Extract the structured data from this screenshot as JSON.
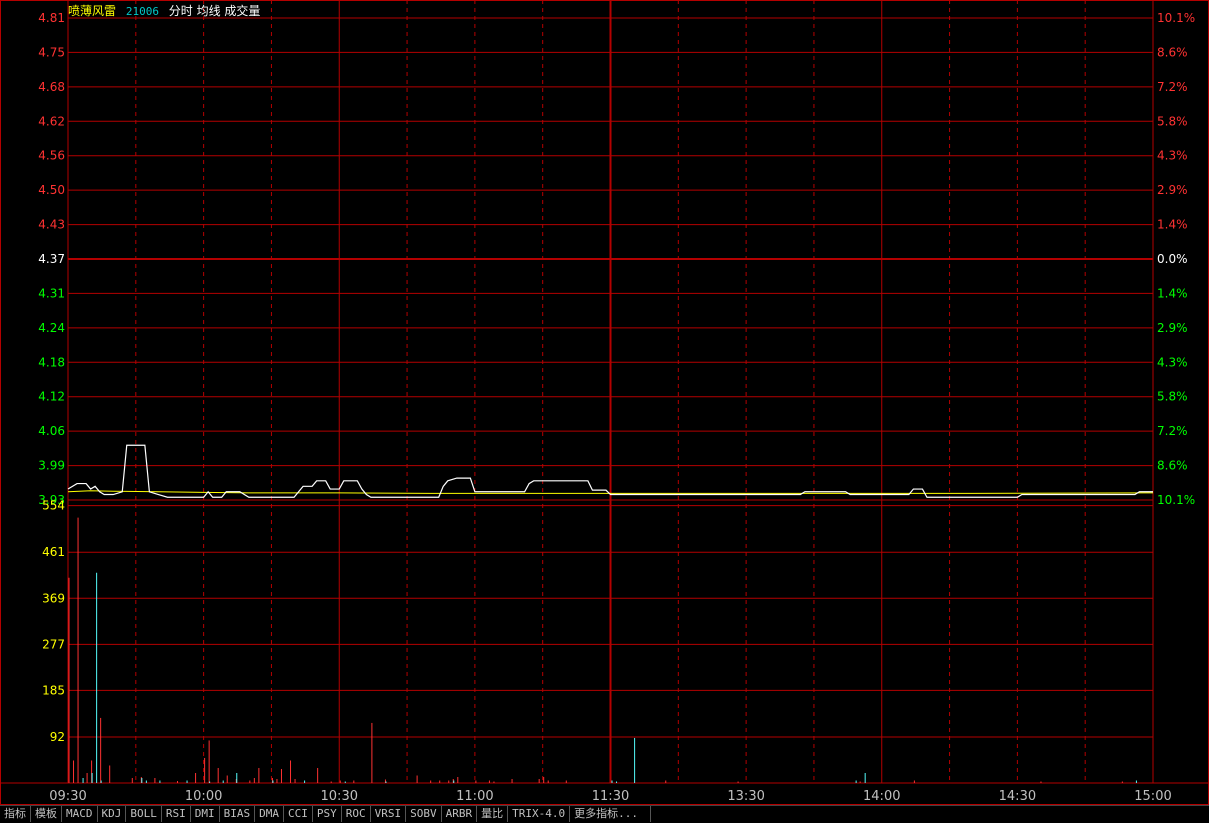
{
  "header": {
    "stock_name": "喷薄风雷",
    "stock_code": "21006",
    "chart_items": "分时 均线 成交量"
  },
  "tabs": [
    "指标",
    "模板",
    "MACD",
    "KDJ",
    "BOLL",
    "RSI",
    "DMI",
    "BIAS",
    "DMA",
    "CCI",
    "PSY",
    "ROC",
    "VRSI",
    "SOBV",
    "ARBR",
    "量比",
    "TRIX-4.0",
    "更多指标..."
  ],
  "colors": {
    "grid": "#b40000",
    "up": "#ff3232",
    "down": "#00ff00",
    "flat": "#ffffff",
    "price_line": "#ffffff",
    "avg_line": "#ffff00",
    "vol_down": "#54fcfc",
    "volume_label": "#ffff00"
  },
  "chart_data": [
    {
      "type": "line",
      "preclose": 4.37,
      "price_ticks_up": [
        "4.81",
        "4.75",
        "4.68",
        "4.62",
        "4.56",
        "4.50",
        "4.43"
      ],
      "price_tick_mid": "4.37",
      "price_ticks_down": [
        "4.31",
        "4.24",
        "4.18",
        "4.12",
        "4.06",
        "3.99",
        "3.93"
      ],
      "pct_ticks_up": [
        "10.1%",
        "8.6%",
        "7.2%",
        "5.8%",
        "4.3%",
        "2.9%",
        "1.4%"
      ],
      "pct_tick_mid": "0.0%",
      "pct_ticks_down": [
        "1.4%",
        "2.9%",
        "4.3%",
        "5.8%",
        "7.2%",
        "8.6%",
        "10.1%"
      ],
      "ylim": [
        3.93,
        4.81
      ],
      "x_ticks": [
        "09:30",
        "10:00",
        "10:30",
        "11:00",
        "11:30",
        "13:30",
        "14:00",
        "14:30",
        "15:00"
      ],
      "total_minutes": 240,
      "series": [
        {
          "points": [
            [
              0,
              3.95
            ],
            [
              2,
              3.96
            ],
            [
              4,
              3.96
            ],
            [
              5,
              3.95
            ],
            [
              6,
              3.955
            ],
            [
              7,
              3.945
            ],
            [
              8,
              3.94
            ],
            [
              10,
              3.94
            ],
            [
              12,
              3.945
            ],
            [
              13,
              4.03
            ],
            [
              17,
              4.03
            ],
            [
              18,
              3.945
            ],
            [
              20,
              3.94
            ],
            [
              22,
              3.935
            ],
            [
              25,
              3.935
            ],
            [
              28,
              3.935
            ],
            [
              29,
              3.935
            ],
            [
              30,
              3.935
            ],
            [
              31,
              3.945
            ],
            [
              32,
              3.935
            ],
            [
              33,
              3.935
            ],
            [
              34,
              3.935
            ],
            [
              35,
              3.945
            ],
            [
              38,
              3.945
            ],
            [
              40,
              3.935
            ],
            [
              50,
              3.935
            ],
            [
              52,
              3.955
            ],
            [
              54,
              3.955
            ],
            [
              55,
              3.965
            ],
            [
              57,
              3.965
            ],
            [
              58,
              3.95
            ],
            [
              60,
              3.95
            ],
            [
              61,
              3.965
            ],
            [
              64,
              3.965
            ],
            [
              65,
              3.95
            ],
            [
              66,
              3.94
            ],
            [
              67,
              3.935
            ],
            [
              82,
              3.935
            ],
            [
              83,
              3.955
            ],
            [
              84,
              3.965
            ],
            [
              86,
              3.97
            ],
            [
              89,
              3.97
            ],
            [
              90,
              3.945
            ],
            [
              101,
              3.945
            ],
            [
              102,
              3.96
            ],
            [
              103,
              3.965
            ],
            [
              115,
              3.965
            ],
            [
              116,
              3.948
            ],
            [
              119,
              3.948
            ],
            [
              120,
              3.94
            ],
            [
              130,
              3.94
            ],
            [
              162,
              3.94
            ],
            [
              163,
              3.945
            ],
            [
              172,
              3.945
            ],
            [
              173,
              3.94
            ],
            [
              186,
              3.94
            ],
            [
              187,
              3.95
            ],
            [
              189,
              3.95
            ],
            [
              190,
              3.935
            ],
            [
              210,
              3.935
            ],
            [
              211,
              3.94
            ],
            [
              236,
              3.94
            ],
            [
              237,
              3.945
            ],
            [
              240,
              3.945
            ]
          ],
          "avg": [
            [
              0,
              3.945
            ],
            [
              5,
              3.947
            ],
            [
              10,
              3.946
            ],
            [
              20,
              3.945
            ],
            [
              30,
              3.944
            ],
            [
              40,
              3.943
            ],
            [
              60,
              3.943
            ],
            [
              80,
              3.942
            ],
            [
              120,
              3.942
            ],
            [
              160,
              3.942
            ],
            [
              200,
              3.942
            ],
            [
              240,
              3.943
            ]
          ]
        }
      ]
    },
    {
      "type": "bar",
      "ytick_labels": [
        "554",
        "461",
        "369",
        "277",
        "185",
        "92"
      ],
      "ylim": [
        0,
        554
      ],
      "bars_up": [
        [
          0,
          410
        ],
        [
          1,
          45
        ],
        [
          2,
          530
        ],
        [
          4,
          20
        ],
        [
          5,
          45
        ],
        [
          7,
          130
        ],
        [
          9,
          35
        ],
        [
          14,
          10
        ],
        [
          16,
          12
        ],
        [
          19,
          10
        ],
        [
          24,
          4
        ],
        [
          28,
          20
        ],
        [
          30,
          50
        ],
        [
          31,
          85
        ],
        [
          33,
          30
        ],
        [
          35,
          15
        ],
        [
          37,
          8
        ],
        [
          40,
          5
        ],
        [
          41,
          10
        ],
        [
          42,
          30
        ],
        [
          45,
          10
        ],
        [
          46,
          8
        ],
        [
          47,
          28
        ],
        [
          49,
          45
        ],
        [
          50,
          8
        ],
        [
          55,
          30
        ],
        [
          58,
          3
        ],
        [
          60,
          5
        ],
        [
          63,
          5
        ],
        [
          67,
          120
        ],
        [
          70,
          7
        ],
        [
          77,
          15
        ],
        [
          80,
          5
        ],
        [
          82,
          5
        ],
        [
          84,
          5
        ],
        [
          85,
          8
        ],
        [
          86,
          12
        ],
        [
          90,
          5
        ],
        [
          93,
          5
        ],
        [
          94,
          3
        ],
        [
          98,
          8
        ],
        [
          104,
          8
        ],
        [
          105,
          12
        ],
        [
          106,
          5
        ],
        [
          110,
          5
        ],
        [
          132,
          5
        ],
        [
          148,
          3
        ],
        [
          175,
          3
        ],
        [
          187,
          5
        ],
        [
          215,
          3
        ],
        [
          233,
          3
        ]
      ],
      "bars_down": [
        [
          3,
          10
        ],
        [
          5,
          20
        ],
        [
          6,
          420
        ],
        [
          7,
          5
        ],
        [
          16,
          10
        ],
        [
          17,
          5
        ],
        [
          20,
          5
        ],
        [
          26,
          5
        ],
        [
          31,
          3
        ],
        [
          34,
          5
        ],
        [
          37,
          20
        ],
        [
          45,
          5
        ],
        [
          52,
          5
        ],
        [
          61,
          3
        ],
        [
          70,
          3
        ],
        [
          85,
          5
        ],
        [
          120,
          5
        ],
        [
          121,
          3
        ],
        [
          125,
          90
        ],
        [
          174,
          5
        ],
        [
          176,
          20
        ],
        [
          236,
          5
        ]
      ]
    }
  ]
}
